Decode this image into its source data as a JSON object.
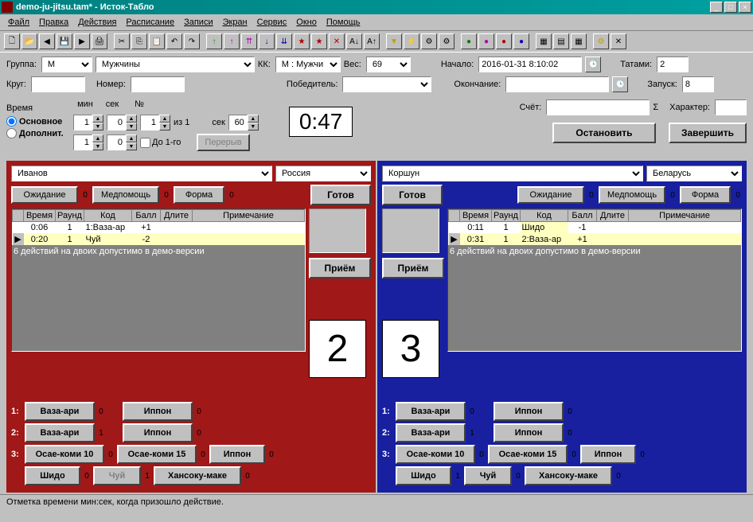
{
  "window": {
    "title": "demo-ju-jitsu.tam* - Исток-Табло"
  },
  "menu": [
    "Файл",
    "Правка",
    "Действия",
    "Расписание",
    "Записи",
    "Экран",
    "Сервис",
    "Окно",
    "Помощь"
  ],
  "top": {
    "group_label": "Группа:",
    "group_code": "M",
    "group_name": "Мужчины",
    "kk_label": "КК:",
    "kk_value": "M : Мужчи",
    "weight_label": "Вес:",
    "weight_value": "69",
    "start_label": "Начало:",
    "start_value": "2016-01-31 8:10:02",
    "tatami_label": "Татами:",
    "tatami_value": "2",
    "circle_label": "Круг:",
    "circle_value": "",
    "number_label": "Номер:",
    "number_value": "",
    "winner_label": "Победитель:",
    "winner_value": "",
    "end_label": "Окончание:",
    "end_value": "",
    "run_label": "Запуск:",
    "run_value": "8",
    "score_label": "Счёт:",
    "score_value": "",
    "hlabel": "Характер:"
  },
  "time": {
    "label": "Время",
    "main": "Основное",
    "extra": "Дополнит.",
    "min_label": "мин",
    "sec_label": "сек",
    "no_label": "№",
    "min": "1",
    "sec": "0",
    "no": "1",
    "of": "из 1",
    "sec2_label": "сек",
    "sec2": "60",
    "extra_min": "1",
    "extra_sec": "0",
    "upto": "До 1-го",
    "break": "Перерыв",
    "timer": "0:47",
    "stop": "Остановить",
    "finish": "Завершить"
  },
  "red": {
    "name": "Иванов",
    "country": "Россия",
    "waiting": "Ожидание",
    "waiting_c": "0",
    "med": "Медпомощь",
    "med_c": "0",
    "form": "Форма",
    "form_c": "0",
    "ready": "Готов",
    "recv": "Приём",
    "score": "2",
    "rows": [
      {
        "t": "0:06",
        "r": "1",
        "k": "1:Ваза-ар",
        "b": "+1",
        "d": "",
        "n": ""
      },
      {
        "t": "0:20",
        "r": "1",
        "k": "Чуй",
        "b": "-2",
        "d": "",
        "n": ""
      }
    ],
    "msg": "6 действий на двоих допустимо в демо-версии"
  },
  "blue": {
    "name": "Коршун",
    "country": "Беларусь",
    "waiting": "Ожидание",
    "waiting_c": "0",
    "med": "Медпомощь",
    "med_c": "0",
    "form": "Форма",
    "form_c": "0",
    "ready": "Готов",
    "recv": "Приём",
    "score": "3",
    "rows": [
      {
        "t": "0:11",
        "r": "1",
        "k": "Шидо",
        "b": "-1",
        "d": "",
        "n": ""
      },
      {
        "t": "0:31",
        "r": "1",
        "k": "2:Ваза-ар",
        "b": "+1",
        "d": "",
        "n": ""
      }
    ],
    "msg": "6 действий на двоих допустимо в демо-версии"
  },
  "table_headers": [
    "",
    "Время",
    "Раунд",
    "Код",
    "Балл",
    "Длите",
    "Примечание"
  ],
  "tech": {
    "vaza": "Ваза-ари",
    "ippon": "Иппон",
    "osae10": "Осае-коми 10",
    "osae15": "Осае-коми 15",
    "shido": "Шидо",
    "chui": "Чуй",
    "hansoku": "Хансоку-маке",
    "c0": "0",
    "c1": "1"
  },
  "status": "Отметка времени мин:сек, когда призошло действие."
}
